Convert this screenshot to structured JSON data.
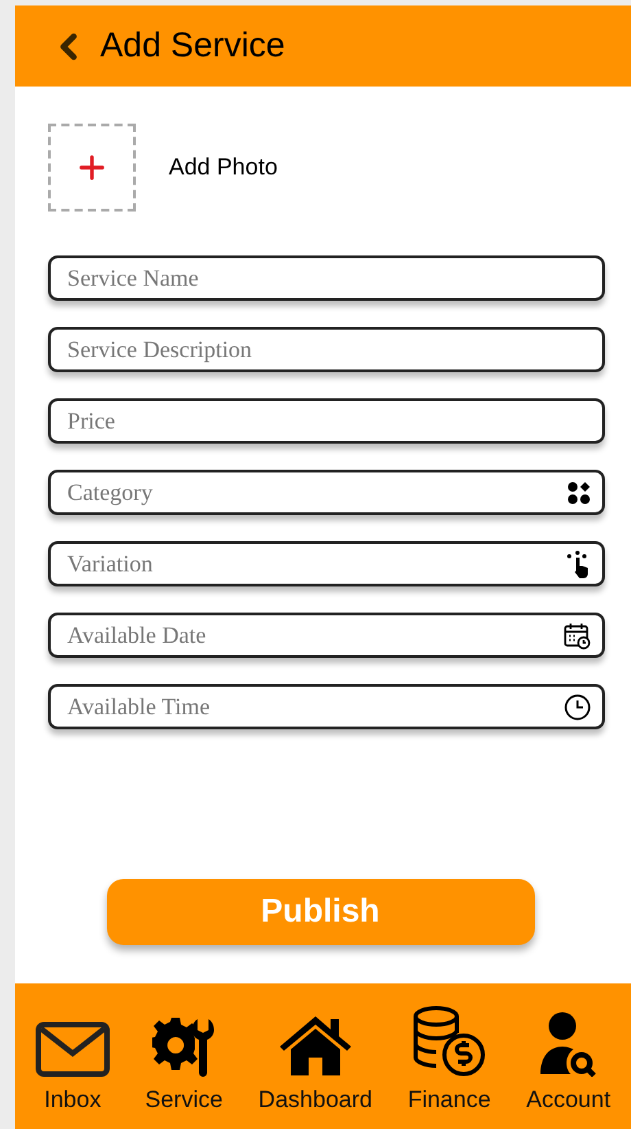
{
  "header": {
    "title": "Add Service"
  },
  "photo": {
    "label": "Add Photo"
  },
  "fields": [
    {
      "kind": "text",
      "placeholder": "Service Name"
    },
    {
      "kind": "text",
      "placeholder": "Service Description"
    },
    {
      "kind": "text",
      "placeholder": "Price"
    },
    {
      "kind": "grid",
      "placeholder": "Category"
    },
    {
      "kind": "tap",
      "placeholder": "Variation"
    },
    {
      "kind": "calendar",
      "placeholder": "Available Date"
    },
    {
      "kind": "clock",
      "placeholder": "Available Time"
    }
  ],
  "publish": {
    "label": "Publish"
  },
  "nav": [
    {
      "kind": "inbox",
      "label": "Inbox"
    },
    {
      "kind": "service",
      "label": "Service"
    },
    {
      "kind": "home",
      "label": "Dashboard"
    },
    {
      "kind": "finance",
      "label": "Finance"
    },
    {
      "kind": "account",
      "label": "Account"
    }
  ]
}
